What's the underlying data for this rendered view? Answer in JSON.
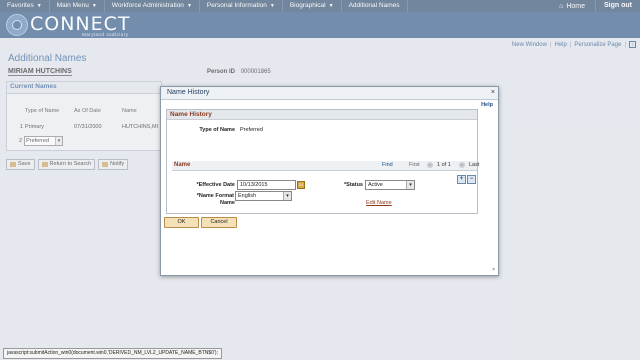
{
  "topnav": {
    "items": [
      {
        "label": "Favorites",
        "caret": true
      },
      {
        "label": "Main Menu",
        "caret": true
      },
      {
        "label": "Workforce Administration",
        "caret": true
      },
      {
        "label": "Personal Information",
        "caret": true
      },
      {
        "label": "Biographical",
        "caret": true
      },
      {
        "label": "Additional Names",
        "caret": false
      }
    ],
    "home": "Home",
    "signout": "Sign out"
  },
  "banner": {
    "logo": "CONNECT",
    "sub": "Maryland Judiciary"
  },
  "tools": {
    "new_window": "New Window",
    "help": "Help",
    "personalize": "Personalize Page",
    "sep": "|"
  },
  "page": {
    "title": "Additional Names",
    "person_name": "MIRIAM HUTCHINS",
    "person_id_label": "Person ID",
    "person_id": "000001865"
  },
  "current_names": {
    "heading": "Current Names",
    "columns": [
      "Type of Name",
      "As Of Date",
      "Name"
    ],
    "rows": [
      {
        "num": "1",
        "type": "Primary",
        "date": "07/31/2000",
        "name": "HUTCHINS,MI"
      }
    ],
    "row2_num": "2",
    "row2_select": "Preferred"
  },
  "actions": {
    "save": "Save",
    "return": "Return to Search",
    "notify": "Notify"
  },
  "modal": {
    "title": "Name History",
    "close": "×",
    "help": "Help",
    "section_title": "Name History",
    "type_of_name_label": "Type of Name",
    "type_of_name_value": "Preferred",
    "name_bar": {
      "title": "Name",
      "find": "Find",
      "first": "First",
      "count": "1 of 1",
      "last": "Last",
      "prev_icon": "‹",
      "next_icon": "›"
    },
    "add_icon": "+",
    "remove_icon": "−",
    "effective_date_label": "*Effective Date",
    "effective_date_value": "10/13/2015",
    "cal_icon": "31",
    "status_label": "*Status",
    "status_value": "Active",
    "name_label": "Name",
    "edit_name_link": "Edit Name",
    "name_format_label": "*Name Format",
    "name_format_value": "English",
    "ok": "OK",
    "cancel": "Cancel",
    "resize": "×"
  },
  "statusbar": {
    "text": "javascript:submitAction_win0(document.win0,'DERIVED_NM_LVL2_UPDATE_NAME_BTN$0');"
  }
}
